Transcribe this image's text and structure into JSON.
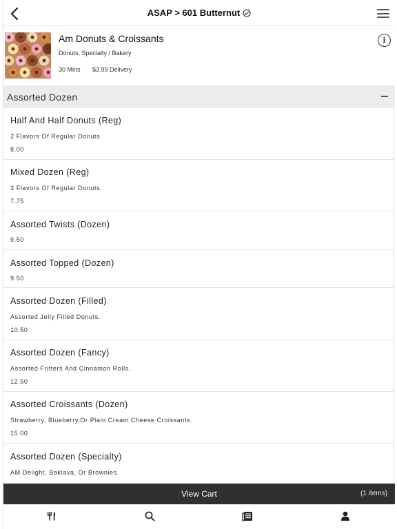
{
  "header": {
    "title": "ASAP > 601 Butternut"
  },
  "store": {
    "name": "Am Donuts & Croissants",
    "categories": "Donuts, Specialty / Bakery",
    "delivery_time": "30 Mins",
    "delivery_fee": "$3.99 Delivery"
  },
  "section": {
    "title": "Assorted Dozen"
  },
  "menu_items": [
    {
      "name": "Half And Half Donuts (Reg)",
      "description": "2 Flavors Of Regular Donuts.",
      "price": "8.00"
    },
    {
      "name": "Mixed Dozen (Reg)",
      "description": "3 Flavors Of Regular Donuts.",
      "price": "7.75"
    },
    {
      "name": "Assorted Twists (Dozen)",
      "description": "",
      "price": "9.50"
    },
    {
      "name": "Assorted Topped (Dozen)",
      "description": "",
      "price": "9.50"
    },
    {
      "name": "Assorted Dozen (Filled)",
      "description": "Assorted Jelly Filled Donuts.",
      "price": "10.50"
    },
    {
      "name": "Assorted Dozen (Fancy)",
      "description": "Assorted Fritters And Cinnamon Rolls.",
      "price": "12.50"
    },
    {
      "name": "Assorted Croissants (Dozen)",
      "description": "Strawberry, Blueberry,Or Plain Cream Cheese Croissants.",
      "price": "15.00"
    },
    {
      "name": "Assorted Dozen (Specialty)",
      "description": "AM Delight, Baklava, Or Brownies.",
      "price": ""
    }
  ],
  "cart": {
    "label": "View Cart",
    "count": "(1 items)"
  },
  "tabs": [
    {
      "name": "menu",
      "icon": "fork-knife-icon"
    },
    {
      "name": "search",
      "icon": "search-icon"
    },
    {
      "name": "orders",
      "icon": "receipt-icon"
    },
    {
      "name": "account",
      "icon": "user-icon"
    }
  ],
  "colors": {
    "section_bg": "#ececec",
    "cart_bar": "#303030",
    "divider": "#e6e6e6"
  }
}
